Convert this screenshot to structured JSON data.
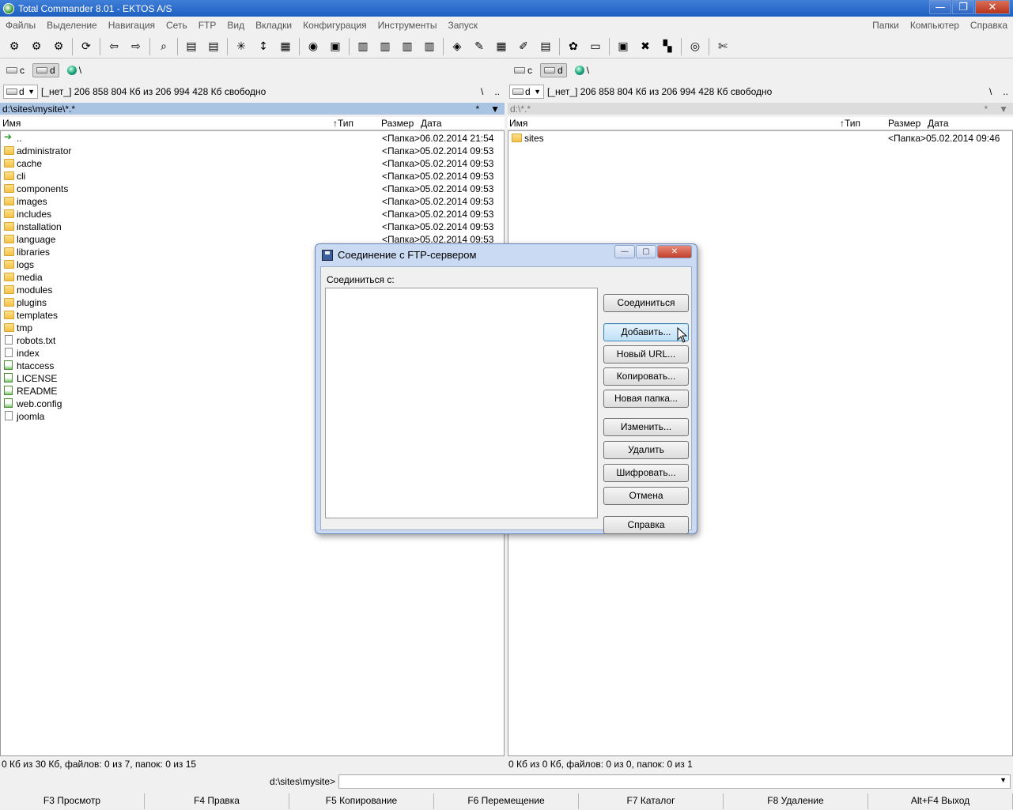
{
  "window": {
    "title": "Total Commander 8.01 - EKTOS A/S",
    "min": "—",
    "max": "❐",
    "close": "✕"
  },
  "menu": {
    "left": [
      "Файлы",
      "Выделение",
      "Навигация",
      "Сеть",
      "FTP",
      "Вид",
      "Вкладки",
      "Конфигурация",
      "Инструменты",
      "Запуск"
    ],
    "right": [
      "Папки",
      "Компьютер",
      "Справка"
    ]
  },
  "toolbar": [
    "⚙",
    "⚙",
    "⚙",
    "|",
    "⟳",
    "|",
    "⇦",
    "⇨",
    "|",
    "⌕",
    "|",
    "▤",
    "▤",
    "|",
    "✳",
    "↕",
    "▦",
    "|",
    "◉",
    "▣",
    "|",
    "▥",
    "▥",
    "▥",
    "▥",
    "|",
    "◈",
    "✎",
    "▦",
    "✐",
    "▤",
    "|",
    "✿",
    "▭",
    "|",
    "▣",
    "✖",
    "▚",
    "|",
    "◎",
    "|",
    "✄"
  ],
  "left": {
    "drives": {
      "c": "c",
      "d": "d",
      "net": "\\"
    },
    "combo": "d",
    "free": "[_нет_]  206 858 804 Кб из 206 994 428 Кб свободно",
    "root": "\\",
    "up": "..",
    "path": "d:\\sites\\mysite\\*.*",
    "star": "*",
    "arrow": "▼",
    "cols": {
      "name": "Имя",
      "type": "↑Тип",
      "size": "Размер",
      "date": "Дата"
    },
    "files": [
      {
        "n": "..",
        "s": "<Папка>",
        "d": "06.02.2014 21:54",
        "k": "up"
      },
      {
        "n": "administrator",
        "s": "<Папка>",
        "d": "05.02.2014 09:53",
        "k": "folder"
      },
      {
        "n": "cache",
        "s": "<Папка>",
        "d": "05.02.2014 09:53",
        "k": "folder"
      },
      {
        "n": "cli",
        "s": "<Папка>",
        "d": "05.02.2014 09:53",
        "k": "folder"
      },
      {
        "n": "components",
        "s": "<Папка>",
        "d": "05.02.2014 09:53",
        "k": "folder"
      },
      {
        "n": "images",
        "s": "<Папка>",
        "d": "05.02.2014 09:53",
        "k": "folder"
      },
      {
        "n": "includes",
        "s": "<Папка>",
        "d": "05.02.2014 09:53",
        "k": "folder"
      },
      {
        "n": "installation",
        "s": "<Папка>",
        "d": "05.02.2014 09:53",
        "k": "folder"
      },
      {
        "n": "language",
        "s": "<Папка>",
        "d": "05.02.2014 09:53",
        "k": "folder"
      },
      {
        "n": "libraries",
        "s": "",
        "d": "",
        "k": "folder"
      },
      {
        "n": "logs",
        "s": "",
        "d": "",
        "k": "folder"
      },
      {
        "n": "media",
        "s": "",
        "d": "",
        "k": "folder"
      },
      {
        "n": "modules",
        "s": "",
        "d": "",
        "k": "folder"
      },
      {
        "n": "plugins",
        "s": "",
        "d": "",
        "k": "folder"
      },
      {
        "n": "templates",
        "s": "",
        "d": "",
        "k": "folder"
      },
      {
        "n": "tmp",
        "s": "",
        "d": "",
        "k": "folder"
      },
      {
        "n": "robots.txt",
        "s": "",
        "d": "",
        "k": "file"
      },
      {
        "n": "index",
        "s": "",
        "d": "",
        "k": "file"
      },
      {
        "n": "htaccess",
        "s": "",
        "d": "",
        "k": "exe"
      },
      {
        "n": "LICENSE",
        "s": "",
        "d": "",
        "k": "exe"
      },
      {
        "n": "README",
        "s": "",
        "d": "",
        "k": "exe"
      },
      {
        "n": "web.config",
        "s": "",
        "d": "",
        "k": "exe"
      },
      {
        "n": "joomla",
        "s": "",
        "d": "",
        "k": "file"
      }
    ],
    "status": "0 Кб из 30 Кб, файлов: 0 из 7, папок: 0 из 15"
  },
  "right": {
    "drives": {
      "c": "c",
      "d": "d",
      "net": "\\"
    },
    "combo": "d",
    "free": "[_нет_]  206 858 804 Кб из 206 994 428 Кб свободно",
    "root": "\\",
    "up": "..",
    "path": "d:\\*.*",
    "star": "*",
    "arrow": "▼",
    "cols": {
      "name": "Имя",
      "type": "↑Тип",
      "size": "Размер",
      "date": "Дата"
    },
    "files": [
      {
        "n": "sites",
        "s": "<Папка>",
        "d": "05.02.2014 09:46",
        "k": "folder"
      }
    ],
    "status": "0 Кб из 0 Кб, файлов: 0 из 0, папок: 0 из 1"
  },
  "cmdline": {
    "path": "d:\\sites\\mysite>",
    "arrow": "▼"
  },
  "fkeys": [
    "F3 Просмотр",
    "F4 Правка",
    "F5 Копирование",
    "F6 Перемещение",
    "F7 Каталог",
    "F8 Удаление",
    "Alt+F4 Выход"
  ],
  "dialog": {
    "title": "Соединение с FTP-сервером",
    "min": "—",
    "max": "▢",
    "close": "✕",
    "connect_to": "Соединиться с:",
    "buttons": {
      "connect": "Соединиться",
      "add": "Добавить...",
      "new_url": "Новый URL...",
      "copy": "Копировать...",
      "new_folder": "Новая папка...",
      "edit": "Изменить...",
      "delete": "Удалить",
      "encrypt": "Шифровать...",
      "cancel": "Отмена",
      "help": "Справка"
    }
  }
}
